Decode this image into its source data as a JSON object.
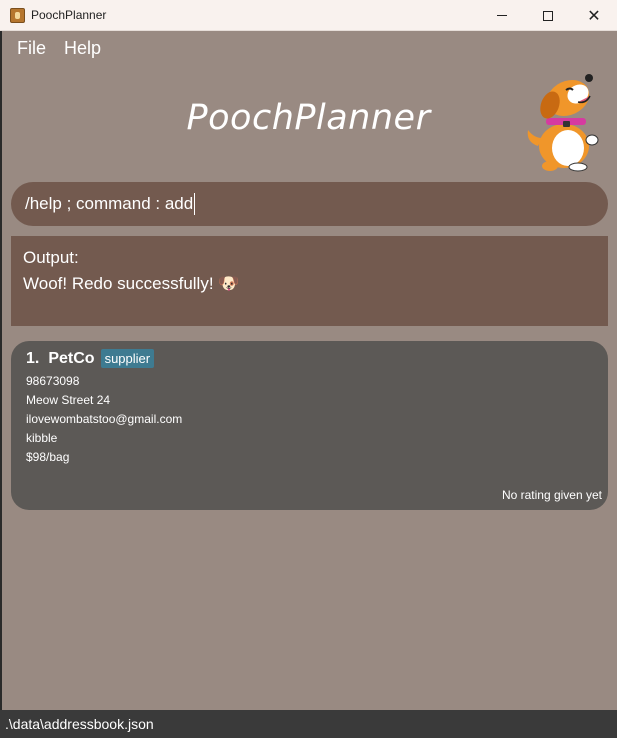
{
  "window": {
    "title": "PoochPlanner",
    "minimize_label": "—",
    "maximize_label": "□",
    "close_label": "✕"
  },
  "menu": {
    "items": [
      "File",
      "Help"
    ]
  },
  "app": {
    "title": "PoochPlanner"
  },
  "command": {
    "value": "/help ; command : add"
  },
  "output": {
    "label": "Output:",
    "message": "Woof! Redo successfully! 🐶"
  },
  "contacts": [
    {
      "index": "1.",
      "name": "PetCo",
      "tag": "supplier",
      "phone": "98673098",
      "address": "Meow Street 24",
      "email": "ilovewombatstoo@gmail.com",
      "product": "kibble",
      "price": "$98/bag",
      "rating": "No rating given yet"
    }
  ],
  "status": {
    "path": ".\\data\\addressbook.json"
  },
  "colors": {
    "background": "#998a82",
    "command_bg": "#735a4f",
    "card_bg": "#5c5956",
    "tag_bg": "#3e7b91",
    "statusbar_bg": "#3a3a3a"
  }
}
